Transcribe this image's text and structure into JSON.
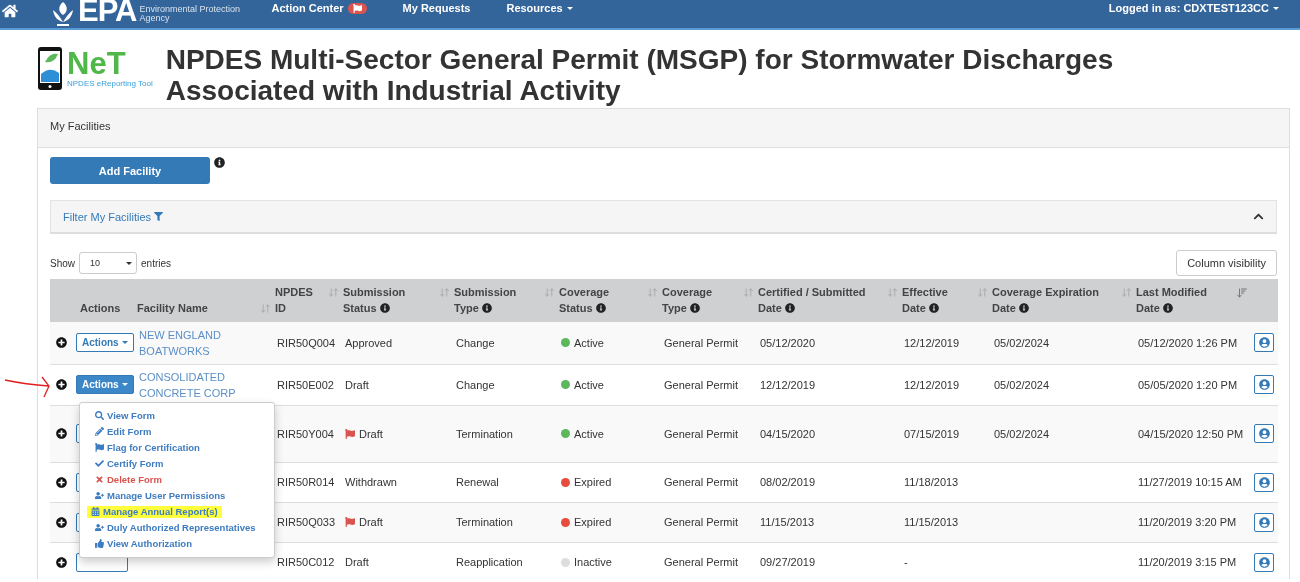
{
  "nav": {
    "logo": {
      "mark": "EPA",
      "agency_lines": [
        "Environmental Protection",
        "Agency"
      ]
    },
    "items": [
      {
        "label": "Action Center",
        "kind": "badge"
      },
      {
        "label": "My Requests",
        "kind": "link"
      },
      {
        "label": "Resources",
        "kind": "dropdown"
      }
    ],
    "user": "Logged in as: CDXTEST123CC"
  },
  "app_logo": {
    "name": "NeT",
    "subtitle": "NPDES eReporting Tool"
  },
  "page_title": "NPDES Multi-Sector General Permit (MSGP) for Stormwater Discharges Associated with Industrial Activity",
  "panel": {
    "title": "My Facilities",
    "add_button": "Add Facility",
    "filter_label": "Filter My Facilities",
    "show_label": "Show",
    "page_size": "10",
    "entries_label": "entries",
    "column_visibility": "Column visibility"
  },
  "table": {
    "columns": [
      {
        "label": "Actions",
        "sortable": false,
        "sorted_desc": false,
        "info": false
      },
      {
        "label": "Facility Name",
        "sortable": true,
        "sorted_desc": false,
        "info": false
      },
      {
        "label": "NPDES ID",
        "sortable": true,
        "sorted_desc": false,
        "info": false
      },
      {
        "label": "Submission Status",
        "sortable": true,
        "sorted_desc": false,
        "info": true
      },
      {
        "label": "Submission Type",
        "sortable": true,
        "sorted_desc": false,
        "info": true
      },
      {
        "label": "Coverage Status",
        "sortable": true,
        "sorted_desc": false,
        "info": true
      },
      {
        "label": "Coverage Type",
        "sortable": true,
        "sorted_desc": false,
        "info": true
      },
      {
        "label": "Certified / Submitted Date",
        "sortable": true,
        "sorted_desc": false,
        "info": true
      },
      {
        "label": "Effective Date",
        "sortable": true,
        "sorted_desc": false,
        "info": true
      },
      {
        "label": "Coverage Expiration Date",
        "sortable": true,
        "sorted_desc": false,
        "info": true
      },
      {
        "label": "Last Modified Date",
        "sortable": true,
        "sorted_desc": true,
        "info": true
      }
    ],
    "rows": [
      {
        "actions": {
          "label": "Actions",
          "open": false
        },
        "facility": "NEW ENGLAND BOATWORKS",
        "npdes_id": "RIR50Q004",
        "submission_status": "Approved",
        "flagged": false,
        "submission_type": "Change",
        "coverage_status": "Active",
        "color": "#5cb85c",
        "coverage_type": "General Permit",
        "certified": "05/12/2020",
        "effective": "12/12/2019",
        "expiration": "05/02/2024",
        "last_modified": "05/12/2020 1:26 PM"
      },
      {
        "actions": {
          "label": "Actions",
          "open": true,
          "menu": [
            {
              "label": "View Form",
              "kind": "view",
              "highlighted": false
            },
            {
              "label": "Edit Form",
              "kind": "edit",
              "highlighted": false
            },
            {
              "label": "Flag for Certification",
              "kind": "flag",
              "highlighted": false
            },
            {
              "label": "Certify Form",
              "kind": "certify",
              "highlighted": false
            },
            {
              "label": "Delete Form",
              "kind": "delete",
              "highlighted": false
            },
            {
              "label": "Manage User Permissions",
              "kind": "users",
              "highlighted": false
            },
            {
              "label": "Manage Annual Report(s)",
              "kind": "calendar",
              "highlighted": true
            },
            {
              "label": "Duly Authorized Representatives",
              "kind": "users",
              "highlighted": false
            },
            {
              "label": "View Authorization",
              "kind": "approve",
              "highlighted": false
            }
          ]
        },
        "facility": "CONSOLIDATED CONCRETE CORP",
        "npdes_id": "RIR50E002",
        "submission_status": "Draft",
        "flagged": false,
        "submission_type": "Change",
        "coverage_status": "Active",
        "color": "#5cb85c",
        "coverage_type": "General Permit",
        "certified": "12/12/2019",
        "effective": "12/12/2019",
        "expiration": "05/02/2024",
        "last_modified": "05/05/2020 1:20 PM"
      },
      {
        "npdes_id": "RIR50Y004",
        "submission_status": "Draft",
        "flagged": true,
        "submission_type": "Termination",
        "coverage_status": "Active",
        "color": "#5cb85c",
        "coverage_type": "General Permit",
        "certified": "04/15/2020",
        "effective": "07/15/2019",
        "expiration": "05/02/2024",
        "last_modified": "04/15/2020 12:50 PM"
      },
      {
        "npdes_id": "RIR50R014",
        "submission_status": "Withdrawn",
        "flagged": false,
        "submission_type": "Renewal",
        "coverage_status": "Expired",
        "color": "#e74c3c",
        "coverage_type": "General Permit",
        "certified": "08/02/2019",
        "effective": "11/18/2013",
        "last_modified": "11/27/2019 10:15 AM"
      },
      {
        "npdes_id": "RIR50Q033",
        "submission_status": "Draft",
        "flagged": true,
        "submission_type": "Termination",
        "coverage_status": "Expired",
        "color": "#e74c3c",
        "coverage_type": "General Permit",
        "certified": "11/15/2013",
        "effective": "11/15/2013",
        "last_modified": "11/20/2019 3:20 PM"
      },
      {
        "npdes_id": "RIR50C012",
        "submission_status": "Draft",
        "flagged": false,
        "submission_type": "Reapplication",
        "coverage_status": "Inactive",
        "color": "#dddddd",
        "coverage_type": "General Permit",
        "certified": "09/27/2019",
        "effective": "-",
        "last_modified": "11/20/2019 3:15 PM"
      }
    ]
  }
}
